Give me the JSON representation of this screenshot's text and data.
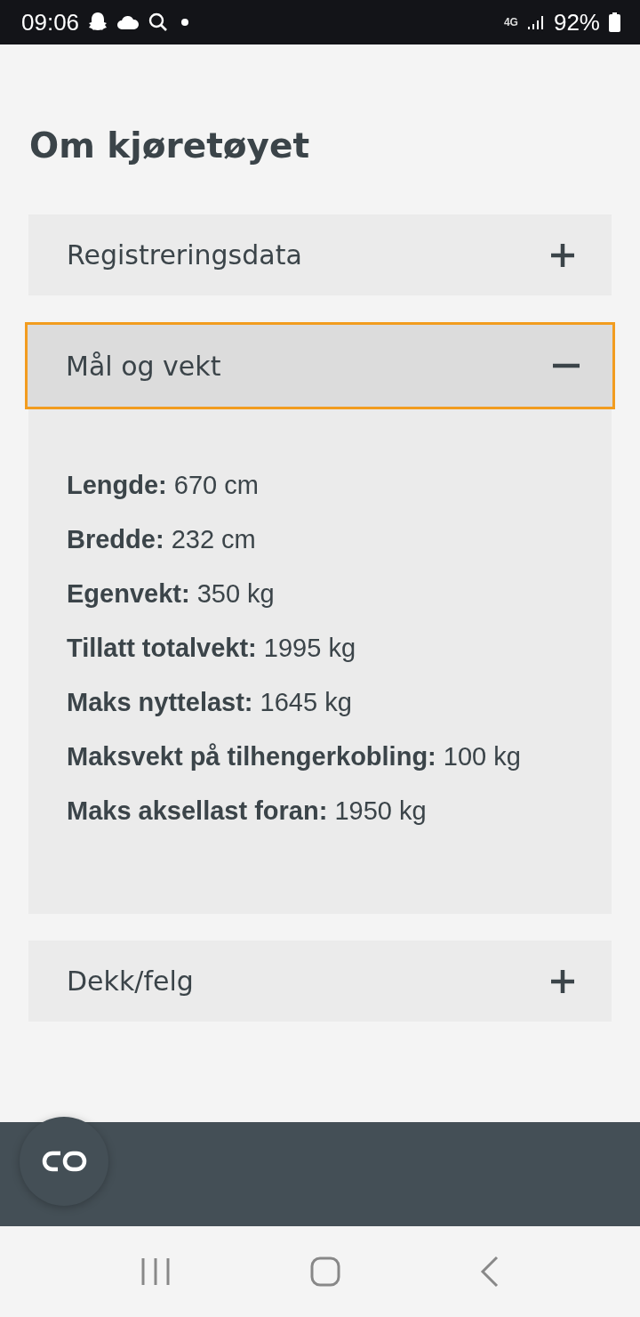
{
  "status_bar": {
    "time": "09:06",
    "network": "4G",
    "battery": "92%"
  },
  "title": "Om kjøretøyet",
  "sections": [
    {
      "title": "Registreringsdata",
      "expanded": false,
      "focused": false
    },
    {
      "title": "Mål og vekt",
      "expanded": true,
      "focused": true,
      "details": [
        "**Lengde:** 670 cm",
        "**Bredde:** 232 cm",
        "**Egenvekt:** 350 kg",
        "**Tillatt totalvekt:** 1995 kg",
        "**Maks nyttelast:** 1645 kg",
        "**Maksvekt på tilhengerkobling:** 100 kg",
        "**Maks aksellast foran:** 1950 kg"
      ]
    },
    {
      "title": "Dekk/felg",
      "expanded": false,
      "focused": false
    }
  ]
}
